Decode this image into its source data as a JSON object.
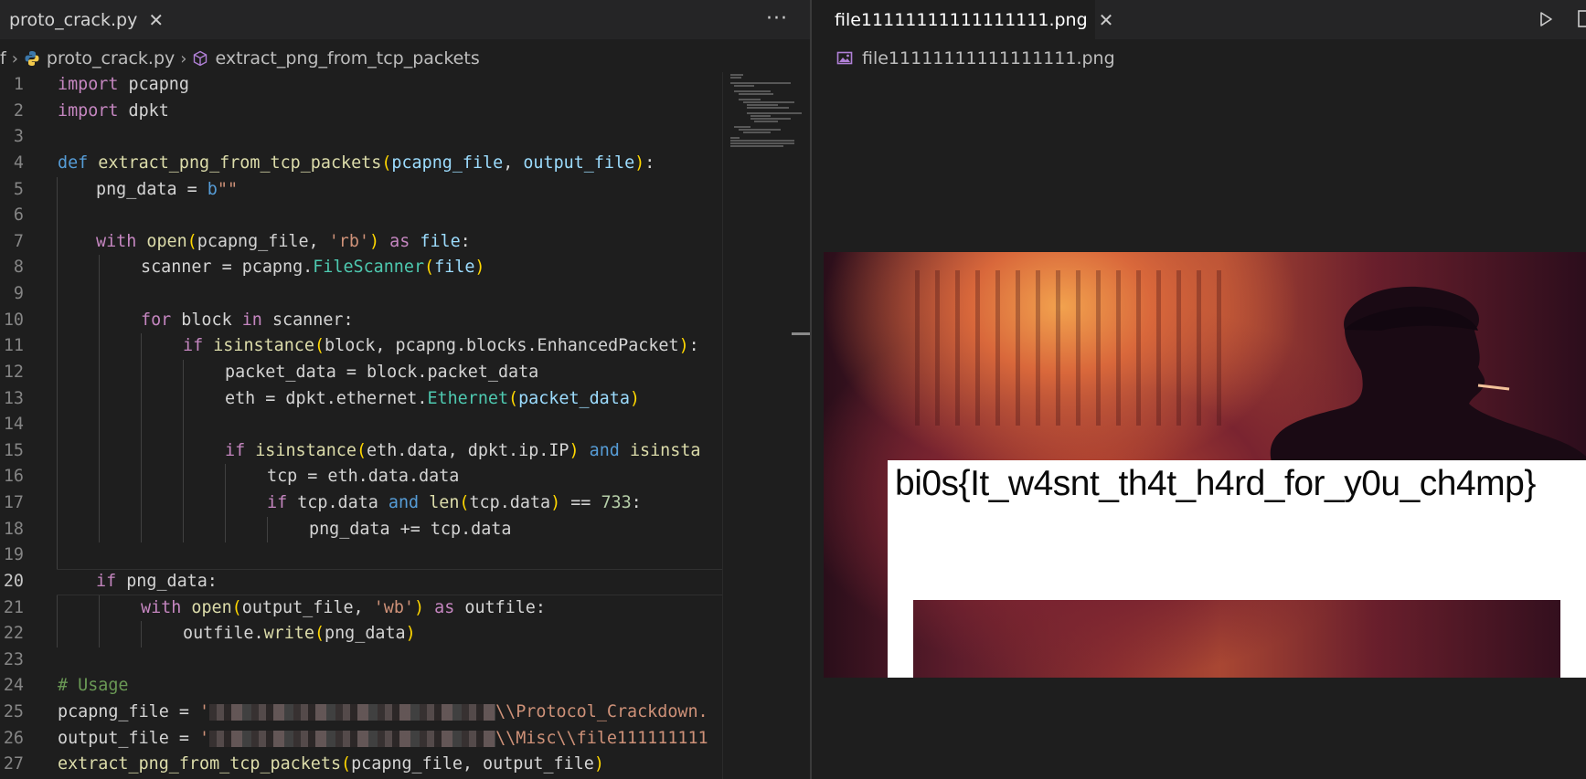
{
  "left_editor": {
    "tab_label": "proto_crack.py",
    "tab_close": "✕",
    "more_actions": "···",
    "breadcrumb": {
      "root": "f",
      "file": "proto_crack.py",
      "symbol": "extract_png_from_tcp_packets"
    },
    "active_line": 20,
    "line_numbers": [
      "1",
      "2",
      "3",
      "4",
      "5",
      "6",
      "7",
      "8",
      "9",
      "10",
      "11",
      "12",
      "13",
      "14",
      "15",
      "16",
      "17",
      "18",
      "19",
      "20",
      "21",
      "22",
      "23",
      "24",
      "25",
      "26",
      "27"
    ],
    "code": {
      "l1_kw": "import",
      "l1_mod": " pcapng",
      "l2_kw": "import",
      "l2_mod": " dpkt",
      "l4_def": "def",
      "l4_fn": "extract_png_from_tcp_packets",
      "l4_p1": "(",
      "l4_a1": "pcapng_file",
      "l4_c": ", ",
      "l4_a2": "output_file",
      "l4_p2": ")",
      "l4_end": ":",
      "l5_var": "png_data",
      "l5_eq": " = ",
      "l5_b": "b",
      "l5_str": "\"\"",
      "l7_kw": "with",
      "l7_fn": "open",
      "l7_p1": "(",
      "l7_a": "pcapng_file, ",
      "l7_s": "'rb'",
      "l7_p2": ")",
      "l7_as": "as",
      "l7_v": "file",
      "l7_end": ":",
      "l8_a": "scanner = pcapng.",
      "l8_fn": "FileScanner",
      "l8_p1": "(",
      "l8_v": "file",
      "l8_p2": ")",
      "l10_kw": "for",
      "l10_a": " block ",
      "l10_in": "in",
      "l10_b": " scanner:",
      "l11_kw": "if",
      "l11_fn": "isinstance",
      "l11_p1": "(",
      "l11_a": "block, pcapng.blocks.EnhancedPacket",
      "l11_p2": ")",
      "l11_end": ":",
      "l12_a": "packet_data = block.packet_data",
      "l13_a": "eth = dpkt.ethernet.",
      "l13_fn": "Ethernet",
      "l13_p1": "(",
      "l13_v": "packet_data",
      "l13_p2": ")",
      "l15_kw": "if",
      "l15_fn": "isinstance",
      "l15_p1": "(",
      "l15_a": "eth.data, dpkt.ip.IP",
      "l15_p2": ")",
      "l15_and": "and",
      "l15_fn2": "isinsta",
      "l16_a": "tcp = eth.data.data",
      "l17_kw": "if",
      "l17_a": " tcp.data ",
      "l17_and": "and",
      "l17_fn": "len",
      "l17_p1": "(",
      "l17_v": "tcp.data",
      "l17_p2": ")",
      "l17_eq": " == ",
      "l17_n": "733",
      "l17_end": ":",
      "l18_a": "png_data += tcp.data",
      "l20_kw": "if",
      "l20_a": " png_data:",
      "l21_kw": "with",
      "l21_fn": "open",
      "l21_p1": "(",
      "l21_a": "output_file, ",
      "l21_s": "'wb'",
      "l21_p2": ")",
      "l21_as": "as",
      "l21_v": " outfile:",
      "l22_a": "outfile.",
      "l22_fn": "write",
      "l22_p1": "(",
      "l22_v": "png_data",
      "l22_p2": ")",
      "l24_c": "# Usage",
      "l25_a": "pcapng_file = ",
      "l25_s1": "'",
      "l25_s2": "\\\\Protocol_Crackdown.",
      "l26_a": "output_file = ",
      "l26_s1": "'",
      "l26_s2": "\\\\Misc\\\\file111111111",
      "l27_fn": "extract_png_from_tcp_packets",
      "l27_p1": "(",
      "l27_a": "pcapng_file, output_file",
      "l27_p2": ")"
    }
  },
  "right_editor": {
    "tab_label": "file11111111111111111.png",
    "tab_close": "✕",
    "breadcrumb_file": "file11111111111111111.png",
    "image_flag_text": "bi0s{It_w4snt_th4t_h4rd_for_y0u_ch4mp}"
  },
  "colors": {
    "editor_bg": "#1e1e1e",
    "keyword": "#c586c0",
    "storage": "#569cd6",
    "function": "#dcdcaa",
    "variable": "#9cdcfe",
    "string": "#ce9178",
    "number": "#b5cea8",
    "comment": "#6a9955"
  },
  "icons": {
    "python_file": "python-icon",
    "symbol": "cube-icon",
    "image_file": "image-file-icon",
    "run": "play-icon",
    "split": "split-editor-icon"
  }
}
